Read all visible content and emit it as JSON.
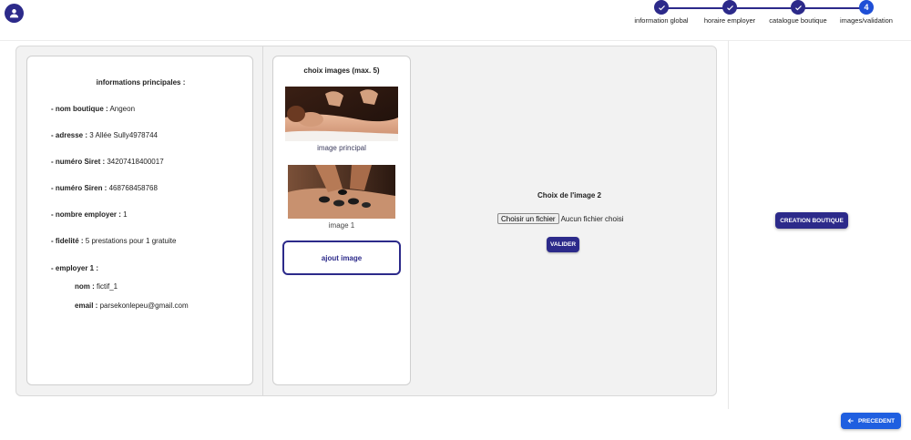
{
  "header": {
    "avatar_icon": "account-circle-icon",
    "steps": [
      {
        "label": "information global",
        "state": "done",
        "icon": "check-icon"
      },
      {
        "label": "horaire employer",
        "state": "done",
        "icon": "check-icon"
      },
      {
        "label": "catalogue boutique",
        "state": "done",
        "icon": "check-icon"
      },
      {
        "label": "images/validation",
        "state": "active",
        "number": "4"
      }
    ]
  },
  "info": {
    "title": "informations principales :",
    "rows": [
      {
        "label": "- nom boutique :",
        "value": " Angeon"
      },
      {
        "label": "- adresse :",
        "value": " 3 Allée Sully4978744"
      },
      {
        "label": "- numéro Siret :",
        "value": " 34207418400017"
      },
      {
        "label": "- numéro Siren :",
        "value": " 468768458768"
      },
      {
        "label": "- nombre employer :",
        "value": " 1"
      },
      {
        "label": "- fidelité :",
        "value": " 5 prestations pour 1 gratuite"
      },
      {
        "label": "- employer 1 :",
        "value": ""
      }
    ],
    "employee": [
      {
        "label": "nom :",
        "value": " fictif_1"
      },
      {
        "label": "email :",
        "value": " parsekonlepeu@gmail.com"
      }
    ]
  },
  "images": {
    "title": "choix images (max. 5)",
    "items": [
      {
        "caption": "image principal"
      },
      {
        "caption": "image 1"
      }
    ],
    "add_label": "ajout image"
  },
  "upload": {
    "title": "Choix de l'image 2",
    "file_button": "Choisir un fichier",
    "file_status": "Aucun fichier choisi",
    "validate_label": "VALIDER"
  },
  "actions": {
    "create_label": "CREATION BOUTIQUE",
    "previous_label": "PRECEDENT",
    "previous_icon": "arrow-left-icon"
  },
  "colors": {
    "primary": "#2c2a8a",
    "accent_blue": "#1f5fe0",
    "panel_bg": "#f2f2f2"
  }
}
